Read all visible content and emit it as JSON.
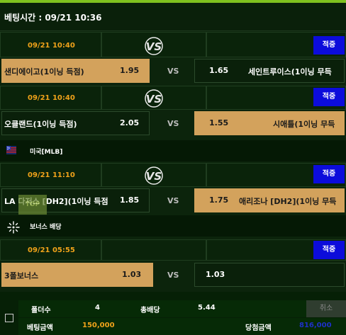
{
  "header": {
    "betting_time": "베팅시간 : 09/21 10:36"
  },
  "games": [
    {
      "date": "09/21 10:40",
      "badge": "적중",
      "home": {
        "team": "샌디에이고(1이닝 득점)",
        "odds": "1.95"
      },
      "vs": "VS",
      "away": {
        "team": "세인트루이스(1이닝 무득",
        "odds": "1.65"
      },
      "selected": "home"
    },
    {
      "date": "09/21 10:40",
      "badge": "적중",
      "home": {
        "team": "오클랜드(1이닝 득점)",
        "odds": "2.05"
      },
      "vs": "VS",
      "away": {
        "team": "시애틀(1이닝 무득",
        "odds": "1.55"
      },
      "selected": "away"
    },
    {
      "date": "09/21 11:10",
      "badge": "적중",
      "home": {
        "team": "LA 다저스 [DH2](1이닝 득점",
        "odds": "1.85"
      },
      "vs": "VS",
      "away": {
        "team": "애리조나 [DH2](1이닝 무득",
        "odds": "1.75"
      },
      "selected": "away"
    },
    {
      "date": "09/21 05:55",
      "badge": "적중",
      "home": {
        "team": "3폴보너스",
        "odds": "1.03"
      },
      "vs": "VS",
      "away": {
        "team": "",
        "odds": "1.03"
      },
      "selected": "home"
    }
  ],
  "leagues": [
    {
      "label": "미국[MLB]",
      "icon": "mlb-flag-icon"
    },
    {
      "label": "보너스 배당",
      "icon": "bonus-sparkle-icon"
    }
  ],
  "top_button": "TOP",
  "summary": {
    "folder_label": "폴더수",
    "folder_value": "4",
    "total_odds_label": "총배당",
    "total_odds_value": "5.44",
    "bet_amount_label": "베팅금액",
    "bet_amount_value": "150,000",
    "win_amount_label": "당첨금액",
    "win_amount_value": "816,000",
    "cancel_label": "취소"
  },
  "colors": {
    "accent": "#7fc11f",
    "selected": "#d3a25c",
    "date": "#f0a21a",
    "badge": "#0c0cdb",
    "win_amount": "#1e30c8"
  }
}
